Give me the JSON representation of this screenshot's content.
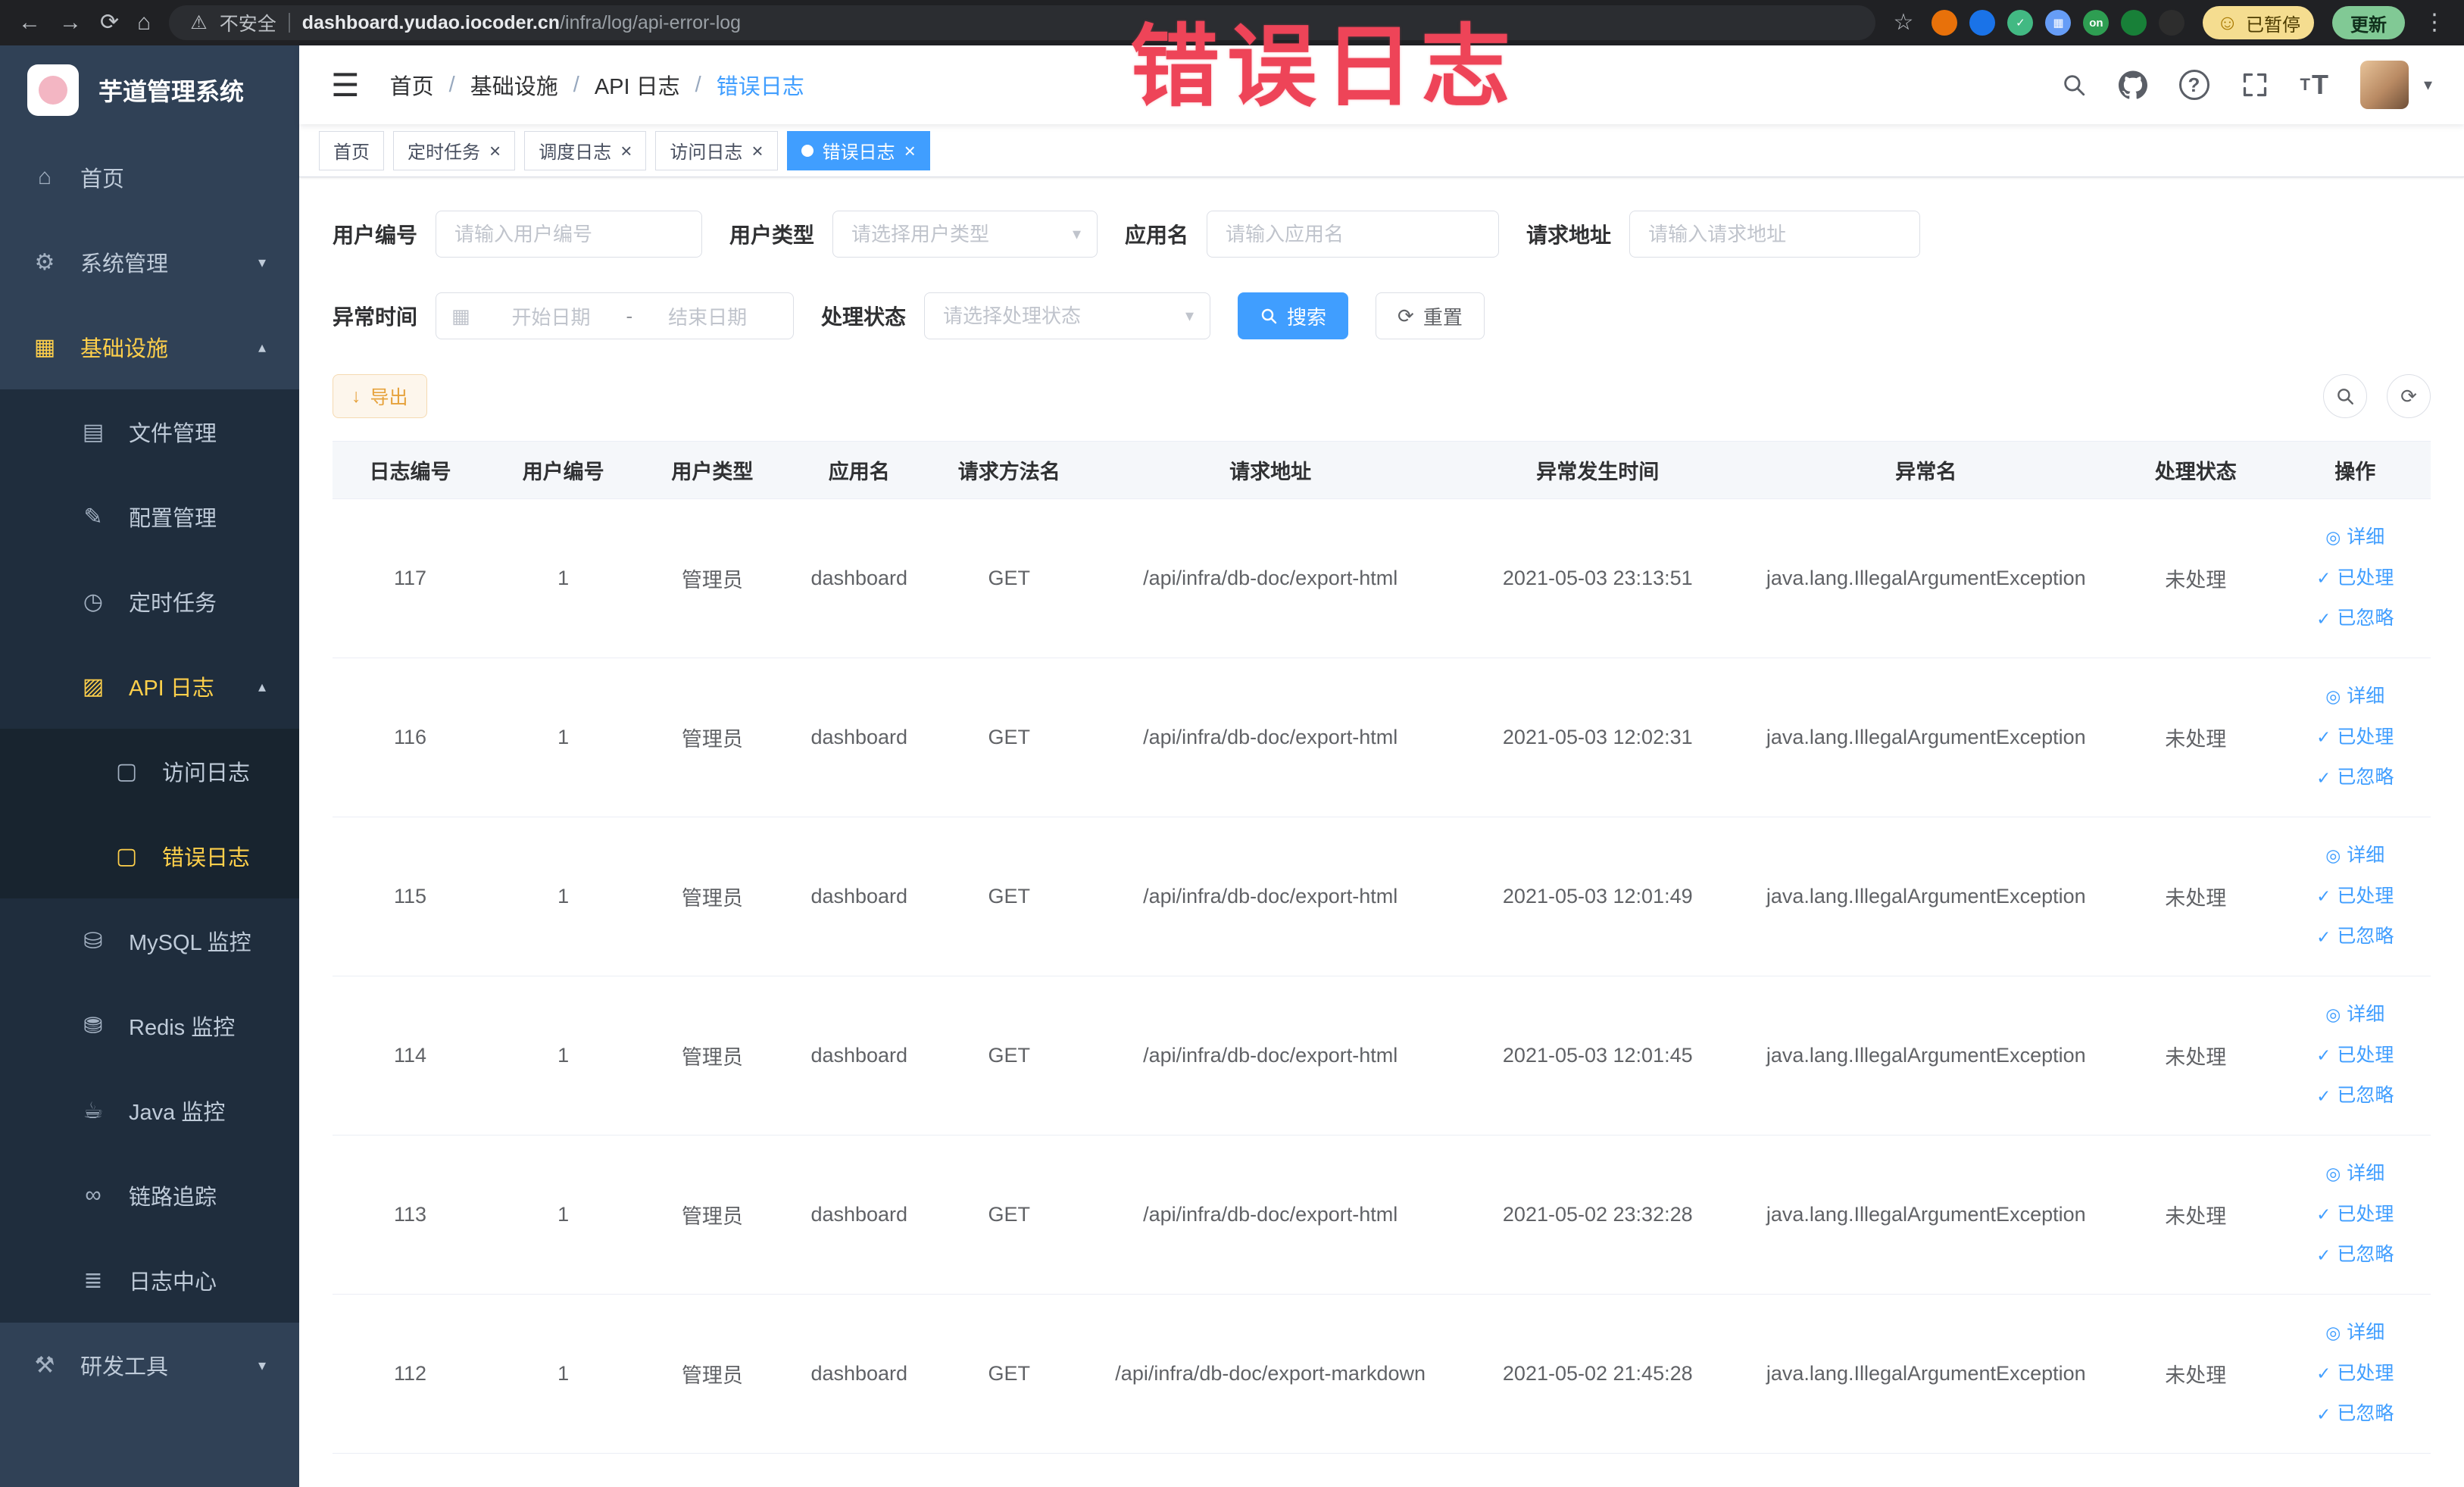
{
  "annotation_text": "错误日志",
  "browser": {
    "security_label": "不安全",
    "url_host": "dashboard.yudao.iocoder.cn",
    "url_path": "/infra/log/api-error-log",
    "paused_label": "已暂停",
    "update_label": "更新",
    "extensions": [
      {
        "bg": "#e8710a",
        "glyph": ""
      },
      {
        "bg": "#1a73e8",
        "glyph": ""
      },
      {
        "bg": "#42b983",
        "glyph": "✓"
      },
      {
        "bg": "#669df6",
        "glyph": "▦"
      },
      {
        "bg": "#2e9e52",
        "glyph": "on"
      },
      {
        "bg": "#188038",
        "glyph": ""
      },
      {
        "bg": "#2d2d2d",
        "glyph": ""
      }
    ]
  },
  "sidebar": {
    "logo_title": "芋道管理系统",
    "items": [
      {
        "key": "home",
        "label": "首页",
        "icon": "home-icon",
        "depth": 1
      },
      {
        "key": "system",
        "label": "系统管理",
        "icon": "gear-icon",
        "depth": 1,
        "expandable": true,
        "expanded": false
      },
      {
        "key": "infra",
        "label": "基础设施",
        "icon": "grid-icon",
        "depth": 1,
        "expandable": true,
        "expanded": true,
        "active": true
      },
      {
        "key": "file",
        "label": "文件管理",
        "icon": "folder-icon",
        "depth": 2
      },
      {
        "key": "config",
        "label": "配置管理",
        "icon": "edit-icon",
        "depth": 2
      },
      {
        "key": "job",
        "label": "定时任务",
        "icon": "timer-icon",
        "depth": 2
      },
      {
        "key": "api-log",
        "label": "API 日志",
        "icon": "log-icon",
        "depth": 2,
        "expandable": true,
        "expanded": true,
        "active": true
      },
      {
        "key": "access-log",
        "label": "访问日志",
        "icon": "doc-icon",
        "depth": 3
      },
      {
        "key": "error-log",
        "label": "错误日志",
        "icon": "doc-icon",
        "depth": 3,
        "active": true
      },
      {
        "key": "mysql",
        "label": "MySQL 监控",
        "icon": "database-icon",
        "depth": 2
      },
      {
        "key": "redis",
        "label": "Redis 监控",
        "icon": "redis-icon",
        "depth": 2
      },
      {
        "key": "java",
        "label": "Java 监控",
        "icon": "java-icon",
        "depth": 2
      },
      {
        "key": "trace",
        "label": "链路追踪",
        "icon": "trace-icon",
        "depth": 2
      },
      {
        "key": "log-center",
        "label": "日志中心",
        "icon": "log-center-icon",
        "depth": 2
      },
      {
        "key": "dev-tools",
        "label": "研发工具",
        "icon": "tools-icon",
        "depth": 1,
        "expandable": true,
        "expanded": false
      }
    ]
  },
  "icons": {
    "home-icon": "⌂",
    "gear-icon": "⚙",
    "grid-icon": "▦",
    "folder-icon": "▤",
    "edit-icon": "✎",
    "timer-icon": "◷",
    "log-icon": "▨",
    "doc-icon": "▢",
    "database-icon": "⛁",
    "redis-icon": "⛃",
    "java-icon": "☕",
    "trace-icon": "∞",
    "log-center-icon": "≣",
    "tools-icon": "⚒",
    "chevron_up": "▴",
    "chevron_down": "▾",
    "back": "←",
    "forward": "→",
    "reload": "⟳",
    "chrome_home": "⌂",
    "warning": "⚠",
    "star": "☆",
    "dots": "⋮",
    "hamburger": "☰",
    "question": "?",
    "caret": "▾",
    "smiley": "☺",
    "calendar": "▦",
    "refresh": "⟳",
    "export_arrow": "↓",
    "detail_glyph": "◎",
    "check_glyph": "✓",
    "select_arrow": "▾",
    "close": "×"
  },
  "header": {
    "breadcrumb": [
      "首页",
      "基础设施",
      "API 日志",
      "错误日志"
    ],
    "breadcrumb_separator": "/"
  },
  "tabs": [
    {
      "key": "home",
      "label": "首页",
      "closable": false,
      "active": false
    },
    {
      "key": "job",
      "label": "定时任务",
      "closable": true,
      "active": false
    },
    {
      "key": "job-log",
      "label": "调度日志",
      "closable": true,
      "active": false
    },
    {
      "key": "access-log",
      "label": "访问日志",
      "closable": true,
      "active": false
    },
    {
      "key": "error-log",
      "label": "错误日志",
      "closable": true,
      "active": true
    }
  ],
  "filters": {
    "user_id_label": "用户编号",
    "user_id_placeholder": "请输入用户编号",
    "user_type_label": "用户类型",
    "user_type_placeholder": "请选择用户类型",
    "app_name_label": "应用名",
    "app_name_placeholder": "请输入应用名",
    "request_url_label": "请求地址",
    "request_url_placeholder": "请输入请求地址",
    "time_label": "异常时间",
    "time_start_placeholder": "开始日期",
    "time_separator": "-",
    "time_end_placeholder": "结束日期",
    "status_label": "处理状态",
    "status_placeholder": "请选择处理状态",
    "search_label": "搜索",
    "reset_label": "重置"
  },
  "toolbar": {
    "export_label": "导出"
  },
  "table": {
    "columns": [
      "日志编号",
      "用户编号",
      "用户类型",
      "应用名",
      "请求方法名",
      "请求地址",
      "异常发生时间",
      "异常名",
      "处理状态",
      "操作"
    ],
    "action_labels": {
      "detail": "详细",
      "processed": "已处理",
      "ignored": "已忽略"
    },
    "rows": [
      {
        "id": "117",
        "user_id": "1",
        "user_type": "管理员",
        "app": "dashboard",
        "method": "GET",
        "url": "/api/infra/db-doc/export-html",
        "time": "2021-05-03 23:13:51",
        "exception": "java.lang.IllegalArgumentException",
        "status": "未处理"
      },
      {
        "id": "116",
        "user_id": "1",
        "user_type": "管理员",
        "app": "dashboard",
        "method": "GET",
        "url": "/api/infra/db-doc/export-html",
        "time": "2021-05-03 12:02:31",
        "exception": "java.lang.IllegalArgumentException",
        "status": "未处理"
      },
      {
        "id": "115",
        "user_id": "1",
        "user_type": "管理员",
        "app": "dashboard",
        "method": "GET",
        "url": "/api/infra/db-doc/export-html",
        "time": "2021-05-03 12:01:49",
        "exception": "java.lang.IllegalArgumentException",
        "status": "未处理"
      },
      {
        "id": "114",
        "user_id": "1",
        "user_type": "管理员",
        "app": "dashboard",
        "method": "GET",
        "url": "/api/infra/db-doc/export-html",
        "time": "2021-05-03 12:01:45",
        "exception": "java.lang.IllegalArgumentException",
        "status": "未处理"
      },
      {
        "id": "113",
        "user_id": "1",
        "user_type": "管理员",
        "app": "dashboard",
        "method": "GET",
        "url": "/api/infra/db-doc/export-html",
        "time": "2021-05-02 23:32:28",
        "exception": "java.lang.IllegalArgumentException",
        "status": "未处理"
      },
      {
        "id": "112",
        "user_id": "1",
        "user_type": "管理员",
        "app": "dashboard",
        "method": "GET",
        "url": "/api/infra/db-doc/export-markdown",
        "time": "2021-05-02 21:45:28",
        "exception": "java.lang.IllegalArgumentException",
        "status": "未处理"
      }
    ]
  },
  "colors": {
    "primary": "#409eff",
    "sidebar_bg": "#304156",
    "submenu_bg": "#1f2d3d",
    "menu_active": "#ffd04b",
    "warning": "#e6a23c",
    "annotation": "#ee4458"
  }
}
